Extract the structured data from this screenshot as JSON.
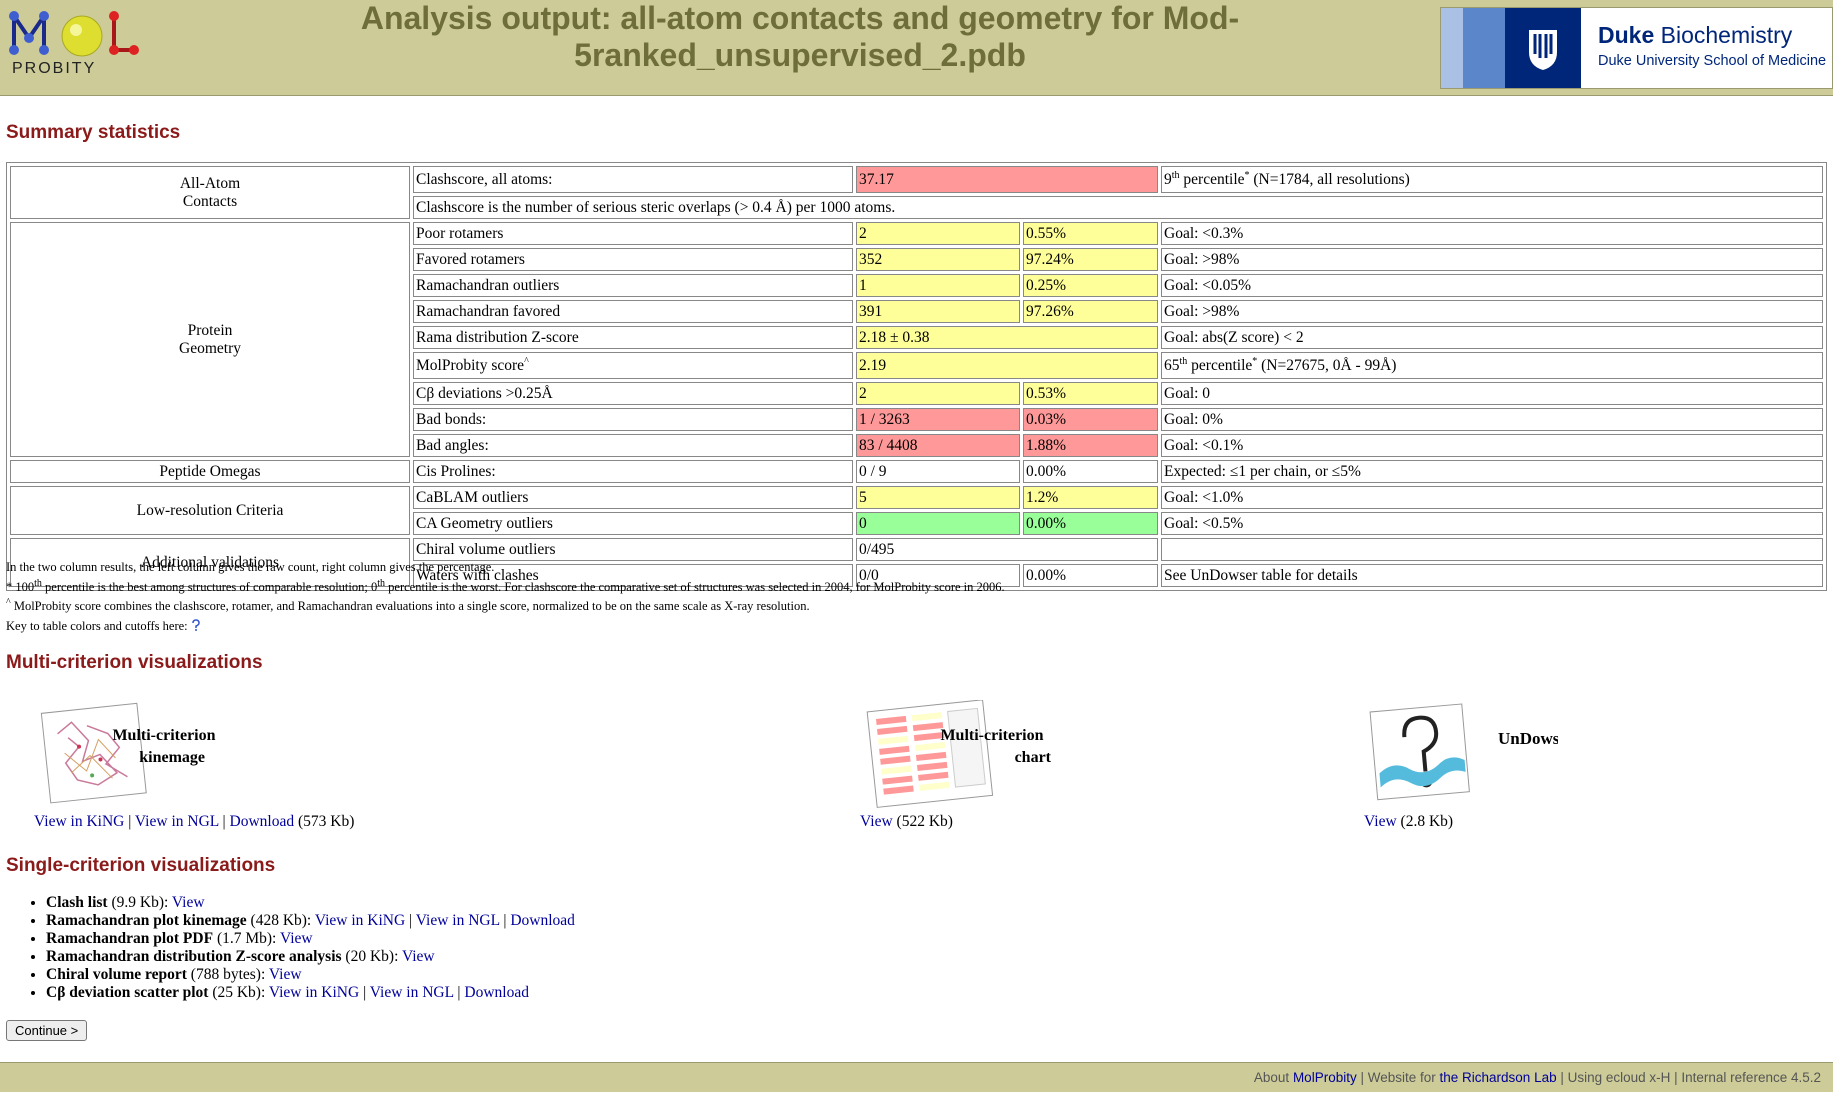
{
  "header": {
    "logo_text": "PROBITY",
    "title": "Analysis output: all-atom contacts and geometry for Mod-5ranked_unsupervised_2.pdb",
    "duke_name_bold": "Duke",
    "duke_name_rest": " Biochemistry",
    "duke_sub": "Duke University School of Medicine"
  },
  "summary": {
    "heading": "Summary statistics",
    "categories": {
      "allatom": "All-Atom Contacts",
      "geometry": "Protein Geometry",
      "omegas": "Peptide Omegas",
      "lowres": "Low-resolution Criteria",
      "additional": "Additional validations"
    },
    "rows": {
      "clash": {
        "label": "Clashscore, all atoms:",
        "value": "37.17",
        "pct_num": "9",
        "pct_sup": "th",
        "pct_text": " percentile",
        "pct_star": "*",
        "pct_tail": " (N=1784, all resolutions)"
      },
      "clash_note": "Clashscore is the number of serious steric overlaps (> 0.4 Å) per 1000 atoms.",
      "poor_rot": {
        "label": "Poor rotamers",
        "count": "2",
        "pct": "0.55%",
        "goal": "Goal: <0.3%"
      },
      "fav_rot": {
        "label": "Favored rotamers",
        "count": "352",
        "pct": "97.24%",
        "goal": "Goal: >98%"
      },
      "rama_out": {
        "label": "Ramachandran outliers",
        "count": "1",
        "pct": "0.25%",
        "goal": "Goal: <0.05%"
      },
      "rama_fav": {
        "label": "Ramachandran favored",
        "count": "391",
        "pct": "97.26%",
        "goal": "Goal: >98%"
      },
      "rama_z": {
        "label": "Rama distribution Z-score",
        "value": "2.18 ± 0.38",
        "goal": "Goal: abs(Z score) < 2"
      },
      "molprob": {
        "label": "MolProbity score",
        "label_sup": "^",
        "value": "2.19",
        "pct_num": "65",
        "pct_sup": "th",
        "pct_text": " percentile",
        "pct_star": "*",
        "pct_tail": " (N=27675, 0Å - 99Å)"
      },
      "cb": {
        "label": "Cβ deviations >0.25Å",
        "count": "2",
        "pct": "0.53%",
        "goal": "Goal: 0"
      },
      "bonds": {
        "label": "Bad bonds:",
        "count": "1 / 3263",
        "pct": "0.03%",
        "goal": "Goal: 0%"
      },
      "angles": {
        "label": "Bad angles:",
        "count": "83 / 4408",
        "pct": "1.88%",
        "goal": "Goal: <0.1%"
      },
      "cispro": {
        "label": "Cis Prolines:",
        "count": "0 / 9",
        "pct": "0.00%",
        "goal": "Expected: ≤1 per chain, or ≤5%"
      },
      "cablam": {
        "label": "CaBLAM outliers",
        "count": "5",
        "pct": "1.2%",
        "goal": "Goal: <1.0%"
      },
      "cageom": {
        "label": "CA Geometry outliers",
        "count": "0",
        "pct": "0.00%",
        "goal": "Goal: <0.5%"
      },
      "chiral": {
        "label": "Chiral volume outliers",
        "count": "0/495",
        "goal": ""
      },
      "waters": {
        "label": "Waters with clashes",
        "count": "0/0",
        "pct": "0.00%",
        "goal": "See UnDowser table for details"
      }
    }
  },
  "notes": {
    "n1": "In the two column results, the left column gives the raw count, right column gives the percentage.",
    "n2_star": "* 100",
    "n2_sup1": "th",
    "n2_mid": " percentile is the best among structures of comparable resolution; 0",
    "n2_sup2": "th",
    "n2_tail": " percentile is the worst. For clashscore the comparative set of structures was selected in 2004, for MolProbity score in 2006.",
    "n3_sup": "^",
    "n3": " MolProbity score combines the clashscore, rotamer, and Ramachandran evaluations into a single score, normalized to be on the same scale as X-ray resolution.",
    "n4": "Key to table colors and cutoffs here: "
  },
  "multi": {
    "heading": "Multi-criterion visualizations",
    "kin": {
      "thumb_l1": "Multi-criterion",
      "thumb_l2": "kinemage",
      "link1": "View in KiNG",
      "sep": " | ",
      "link2": "View in NGL",
      "link3": "Download",
      "size": " (573 Kb)"
    },
    "chart": {
      "thumb_l1": "Multi-criterion",
      "thumb_l2": "chart",
      "link1": "View",
      "size": " (522 Kb)"
    },
    "undowser": {
      "thumb_l1": "UnDowser",
      "link1": "View",
      "size": " (2.8 Kb)"
    }
  },
  "single": {
    "heading": "Single-criterion visualizations",
    "items": [
      {
        "name": "Clash list",
        "size": " (9.9 Kb): ",
        "links": [
          "View"
        ]
      },
      {
        "name": "Ramachandran plot kinemage",
        "size": " (428 Kb): ",
        "links": [
          "View in KiNG",
          "View in NGL",
          "Download"
        ]
      },
      {
        "name": "Ramachandran plot PDF",
        "size": " (1.7 Mb): ",
        "links": [
          "View"
        ]
      },
      {
        "name": "Ramachandran distribution Z-score analysis",
        "size": " (20 Kb): ",
        "links": [
          "View"
        ]
      },
      {
        "name": "Chiral volume report",
        "size": " (788 bytes): ",
        "links": [
          "View"
        ]
      },
      {
        "name": "Cβ deviation scatter plot",
        "size": " (25 Kb): ",
        "links": [
          "View in KiNG",
          "View in NGL",
          "Download"
        ]
      }
    ],
    "sep": " | "
  },
  "continue_label": "Continue >",
  "footer": {
    "about": "About ",
    "molprobity": "MolProbity",
    "website": " | Website for ",
    "lab": "the Richardson Lab",
    "rest": " | Using ecloud x-H | Internal reference 4.5.2"
  }
}
